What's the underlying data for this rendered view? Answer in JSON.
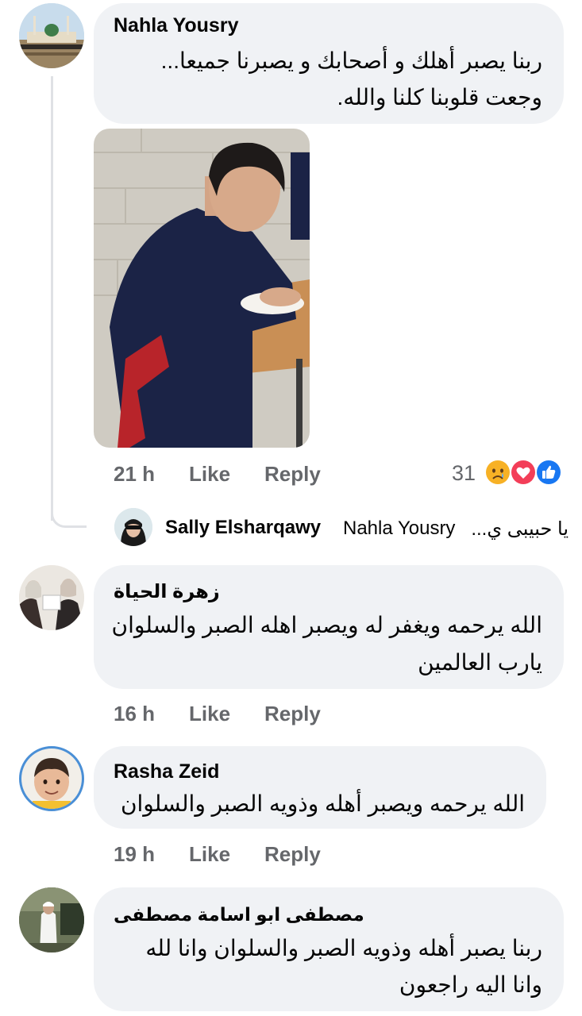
{
  "comments": [
    {
      "author": "Nahla Yousry",
      "text_line1": "ربنا يصبر أهلك و أصحابك و يصبرنا جميعا...",
      "text_line2": "وجعت قلوبنا كلنا والله.",
      "time": "21 h",
      "like": "Like",
      "reply": "Reply",
      "reaction_count": "31",
      "reactions": [
        "like-reaction-icon",
        "love-reaction-icon",
        "sad-reaction-icon"
      ],
      "reply_preview": {
        "author": "Sally Elsharqawy",
        "mention": "Nahla Yousry",
        "text": "يا حبيبى ي..."
      }
    },
    {
      "author": "زهرة الحياة",
      "text_line1": "الله يرحمه ويغفر له ويصبر اهله الصبر والسلوان",
      "text_line2": "يارب العالمين",
      "time": "16 h",
      "like": "Like",
      "reply": "Reply"
    },
    {
      "author": "Rasha Zeid",
      "text_line1": "الله يرحمه ويصبر أهله وذويه الصبر والسلوان",
      "time": "19 h",
      "like": "Like",
      "reply": "Reply"
    },
    {
      "author": "مصطفى ابو اسامة مصطفى",
      "text_line1": "ربنا يصبر أهله وذويه الصبر والسلوان وانا لله",
      "text_line2": "وانا اليه راجعون"
    }
  ],
  "colors": {
    "bubble": "#f0f2f5",
    "meta": "#65676b",
    "like_blue": "#1877f2",
    "love_red": "#f33e58",
    "sad_yellow": "#f7b125"
  }
}
